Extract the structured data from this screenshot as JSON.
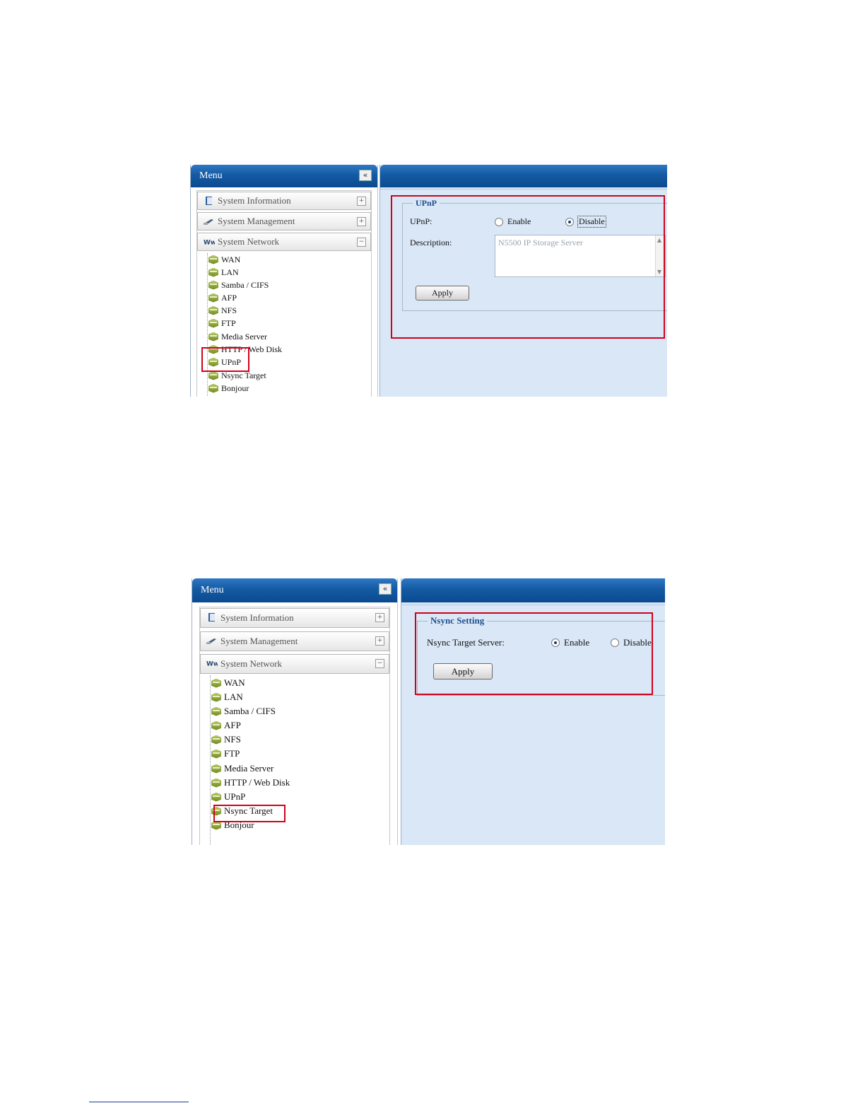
{
  "screen1": {
    "menu": {
      "title": "Menu",
      "collapse_glyph": "«",
      "sections": [
        {
          "label": "System Information",
          "toggle": "+",
          "icon": "book-icon"
        },
        {
          "label": "System Management",
          "toggle": "+",
          "icon": "wrench-icon"
        },
        {
          "label": "System Network",
          "toggle": "−",
          "icon": "network-icon"
        }
      ],
      "items": [
        "WAN",
        "LAN",
        "Samba / CIFS",
        "AFP",
        "NFS",
        "FTP",
        "Media Server",
        "HTTP / Web Disk",
        "UPnP",
        "Nsync Target",
        "Bonjour"
      ]
    },
    "panel": {
      "legend": "UPnP",
      "upnp_label": "UPnP:",
      "enable_label": "Enable",
      "disable_label": "Disable",
      "selected": "Disable",
      "description_label": "Description:",
      "description_placeholder": "N5500 IP Storage Server",
      "apply_label": "Apply"
    }
  },
  "screen2": {
    "menu": {
      "title": "Menu",
      "collapse_glyph": "«",
      "sections": [
        {
          "label": "System Information",
          "toggle": "+",
          "icon": "book-icon"
        },
        {
          "label": "System Management",
          "toggle": "+",
          "icon": "wrench-icon"
        },
        {
          "label": "System Network",
          "toggle": "−",
          "icon": "network-icon"
        }
      ],
      "items": [
        "WAN",
        "LAN",
        "Samba / CIFS",
        "AFP",
        "NFS",
        "FTP",
        "Media Server",
        "HTTP / Web Disk",
        "UPnP",
        "Nsync Target",
        "Bonjour"
      ]
    },
    "panel": {
      "legend": "Nsync Setting",
      "server_label": "Nsync Target Server:",
      "enable_label": "Enable",
      "disable_label": "Disable",
      "selected": "Enable",
      "apply_label": "Apply"
    }
  },
  "colors": {
    "header_blue": "#145aa3",
    "content_bg": "#dae7f6",
    "highlight_red": "#d0021b",
    "legend_blue": "#1f4f8f"
  }
}
